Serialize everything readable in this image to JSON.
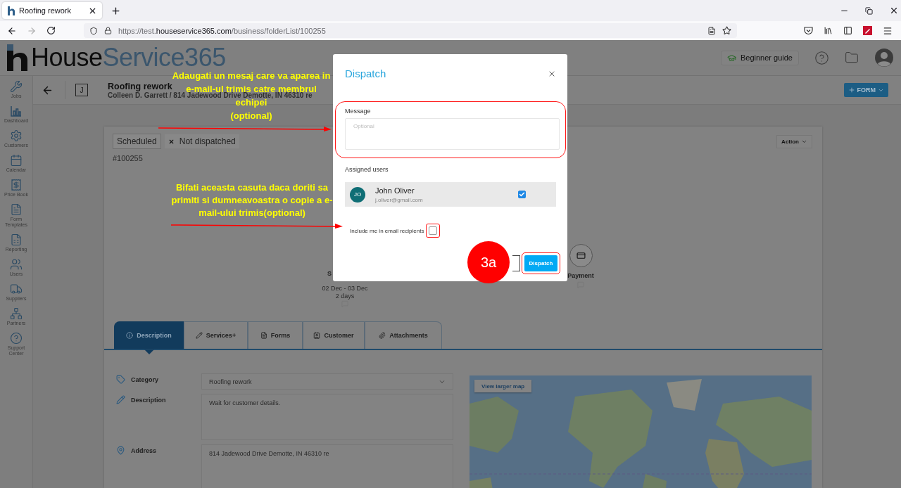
{
  "browser": {
    "tab_title": "Roofing rework",
    "url": "https://test.**houseservice365.com**/business/folderList/100255"
  },
  "header": {
    "logo_first": "House",
    "logo_second": "Service365",
    "guide_button": "Beginner guide"
  },
  "sidebar": {
    "items": [
      {
        "label": "Jobs"
      },
      {
        "label": "Dashboard"
      },
      {
        "label": "Customers"
      },
      {
        "label": "Calendar"
      },
      {
        "label": "Price Book"
      },
      {
        "label": "Form Templates"
      },
      {
        "label": "Reporting"
      },
      {
        "label": "Users"
      },
      {
        "label": "Suppliers"
      },
      {
        "label": "Partners"
      },
      {
        "label": "Support Center"
      }
    ]
  },
  "job": {
    "badge": "J",
    "title": "Roofing rework",
    "subtitle": "Colleen D. Garrett / 814 Jadewood Drive Demotte, IN 46310 re",
    "form_button": "FORM",
    "action_button": "Action",
    "number": "#100255"
  },
  "statuses": [
    {
      "label": "Scheduled",
      "kind": "plain"
    },
    {
      "label": "Not dispatched",
      "kind": "cross"
    }
  ],
  "timeline": [
    {
      "kind": "dated",
      "label": "S",
      "dates": "02 Dec - 03 Dec",
      "duration": "2 days"
    },
    {
      "kind": "step",
      "label": "Payment"
    }
  ],
  "tabs": [
    {
      "label": "Description",
      "selected": true
    },
    {
      "label": "Services+",
      "selected": false
    },
    {
      "label": "Forms",
      "selected": false
    },
    {
      "label": "Customer",
      "selected": false
    },
    {
      "label": "Attachments",
      "selected": false
    }
  ],
  "fields": [
    {
      "label": "Category",
      "kind": "select",
      "value": "Roofing rework"
    },
    {
      "label": "Description",
      "kind": "textarea",
      "value": "Wait for customer details."
    },
    {
      "label": "Address",
      "kind": "textarea",
      "value": "814 Jadewood Drive Demotte, IN 46310 re"
    }
  ],
  "map": {
    "button": "View larger map",
    "kind": "picture"
  },
  "dialog": {
    "title": "Dispatch",
    "message_label": "Message",
    "message_placeholder": "Optional",
    "assigned_label": "Assigned users",
    "users": [
      {
        "initials": "JO",
        "name": "John Oliver",
        "email": "j.oliver@gmail.com",
        "checked": true
      }
    ],
    "include_me": {
      "label": "Include me in email recipients",
      "checked": false
    },
    "submit": "Dispatch"
  },
  "annotations": {
    "callouts": [
      {
        "lines": [
          "Adaugati un mesaj care va aparea in",
          "e-mail-ul trimis catre membrul",
          "echipei",
          "(optional)"
        ]
      },
      {
        "lines": [
          "Bifati aceasta casuta daca doriti sa",
          "primiti si dumneavoastra o copie a e-",
          "mail-ului trimis(optional)"
        ]
      }
    ],
    "step": "3a"
  }
}
